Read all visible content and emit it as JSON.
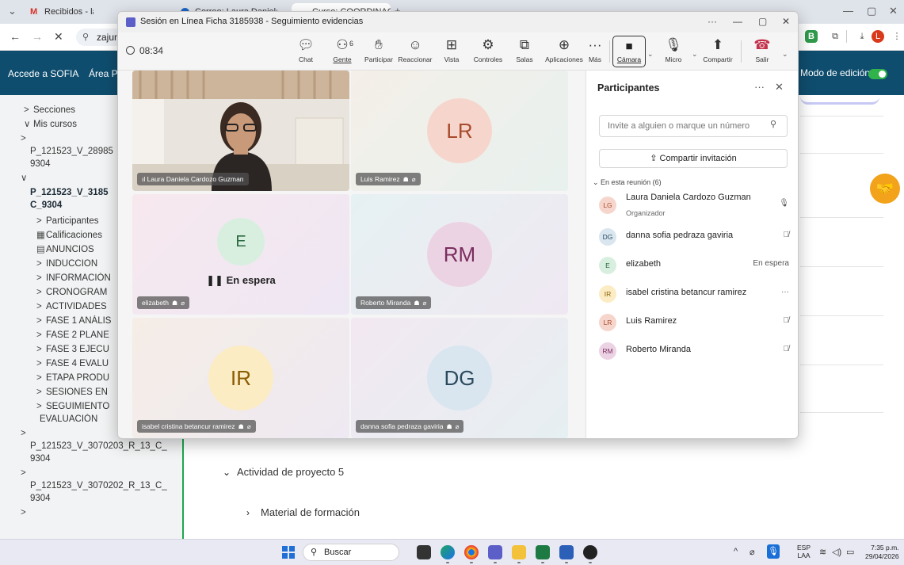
{
  "browser": {
    "tabs": [
      {
        "label": "Recibidos - laurad.cardozo3@..."
      },
      {
        "label": "Correo: Laura Daniela Cardozo"
      },
      {
        "label": "Curso: COORDINACION DE PR..."
      }
    ],
    "url": "zajuna"
  },
  "site": {
    "brand": "Accede a SOFIA",
    "area": "Área Pe",
    "edit_mode_label": "Modo de edición",
    "edit_mode_on": true
  },
  "course_index": {
    "items": [
      {
        "chev": ">",
        "label": "Secciones"
      },
      {
        "chev": "∨",
        "label": "Mis cursos"
      },
      {
        "chev": ">",
        "label": ""
      },
      {
        "chev": "",
        "label": "P_121523_V_28985"
      },
      {
        "chev": "",
        "label": "9304"
      },
      {
        "chev": "∨",
        "label": ""
      },
      {
        "chev": "",
        "label": "P_121523_V_3185"
      },
      {
        "chev": "",
        "label": "C_9304"
      },
      {
        "chev": ">",
        "label": "Participantes"
      },
      {
        "chev": "▦",
        "label": "Calificaciones"
      },
      {
        "chev": "▤",
        "label": "ANUNCIOS"
      },
      {
        "chev": ">",
        "label": "INDUCCION"
      },
      {
        "chev": ">",
        "label": "INFORMACIÓN"
      },
      {
        "chev": ">",
        "label": "CRONOGRAM"
      },
      {
        "chev": ">",
        "label": "ACTIVIDADES"
      },
      {
        "chev": ">",
        "label": "FASE 1 ANÁLIS"
      },
      {
        "chev": ">",
        "label": "FASE 2 PLANE"
      },
      {
        "chev": ">",
        "label": "FASE 3 EJECU"
      },
      {
        "chev": ">",
        "label": "FASE 4 EVALU"
      },
      {
        "chev": ">",
        "label": "ETAPA PRODU"
      },
      {
        "chev": ">",
        "label": "SESIONES EN"
      },
      {
        "chev": ">",
        "label": "SEGUIMIENTO"
      },
      {
        "chev": "",
        "label": "EVALUACIÓN"
      },
      {
        "chev": ">",
        "label": ""
      },
      {
        "chev": "",
        "label": "P_121523_V_3070203_R_13_C_"
      },
      {
        "chev": "",
        "label": "9304"
      },
      {
        "chev": ">",
        "label": ""
      },
      {
        "chev": "",
        "label": "P_121523_V_3070202_R_13_C_"
      },
      {
        "chev": "",
        "label": "9304"
      },
      {
        "chev": ">",
        "label": ""
      }
    ]
  },
  "main": {
    "activity": "Actividad de proyecto 5",
    "material": "Material de formación"
  },
  "teams": {
    "title": "Sesión en Línea Ficha 3185938 - Seguimiento evidencias",
    "timer": "08:34",
    "toolbar": {
      "chat": "Chat",
      "people": "Gente",
      "people_count": "6",
      "raise": "Participar",
      "react": "Reaccionar",
      "view": "Vista",
      "controls": "Controles",
      "rooms": "Salas",
      "apps": "Aplicaciones",
      "more": "Más",
      "camera": "Cámara",
      "mic": "Micro",
      "share": "Compartir",
      "leave": "Salir"
    },
    "tiles": [
      {
        "name": "Laura Daniela Cardozo Guzman",
        "initials": "",
        "video": true
      },
      {
        "name": "Luis Ramirez",
        "initials": "LR",
        "color": "#f6d6cc",
        "text": "#a84a2c"
      },
      {
        "name": "elizabeth",
        "initials": "E",
        "color": "#d8efe0",
        "text": "#2b6a42",
        "on_hold": "En espera"
      },
      {
        "name": "Roberto Miranda",
        "initials": "RM",
        "color": "#ecd3e4",
        "text": "#7a2d5e"
      },
      {
        "name": "isabel cristina betancur ramirez",
        "initials": "IR",
        "color": "#fbecc4",
        "text": "#8a5b00"
      },
      {
        "name": "danna sofia pedraza gaviria",
        "initials": "DG",
        "color": "#d9e6ef",
        "text": "#2c4a5e"
      }
    ],
    "panel": {
      "title": "Participantes",
      "invite_placeholder": "Invite a alguien o marque un número",
      "share_invite": "Compartir invitación",
      "in_meeting": "En esta reunión (6)",
      "participants": [
        {
          "initials": "LG",
          "name": "Laura Daniela Cardozo Guzman",
          "role": "Organizador",
          "status": "🎙",
          "color": "#f6d6cc",
          "text": "#a84a2c"
        },
        {
          "initials": "DG",
          "name": "danna sofia pedraza gaviria",
          "role": "",
          "status": "🎙̸",
          "color": "#d9e6ef",
          "text": "#2c4a5e"
        },
        {
          "initials": "E",
          "name": "elizabeth",
          "role": "",
          "status": "En espera",
          "color": "#d8efe0",
          "text": "#2b6a42"
        },
        {
          "initials": "IR",
          "name": "isabel cristina betancur ramirez",
          "role": "",
          "status": "···",
          "color": "#fbecc4",
          "text": "#8a5b00"
        },
        {
          "initials": "LR",
          "name": "Luis Ramirez",
          "role": "",
          "status": "🎙̸",
          "color": "#f6d6cc",
          "text": "#a84a2c"
        },
        {
          "initials": "RM",
          "name": "Roberto Miranda",
          "role": "",
          "status": "🎙̸",
          "color": "#ecd3e4",
          "text": "#7a2d5e"
        }
      ]
    }
  },
  "taskbar": {
    "search": "Buscar",
    "lang_top": "ESP",
    "lang_bottom": "LAA",
    "time": "7:35 p.m.",
    "date": "29/04/2026"
  }
}
